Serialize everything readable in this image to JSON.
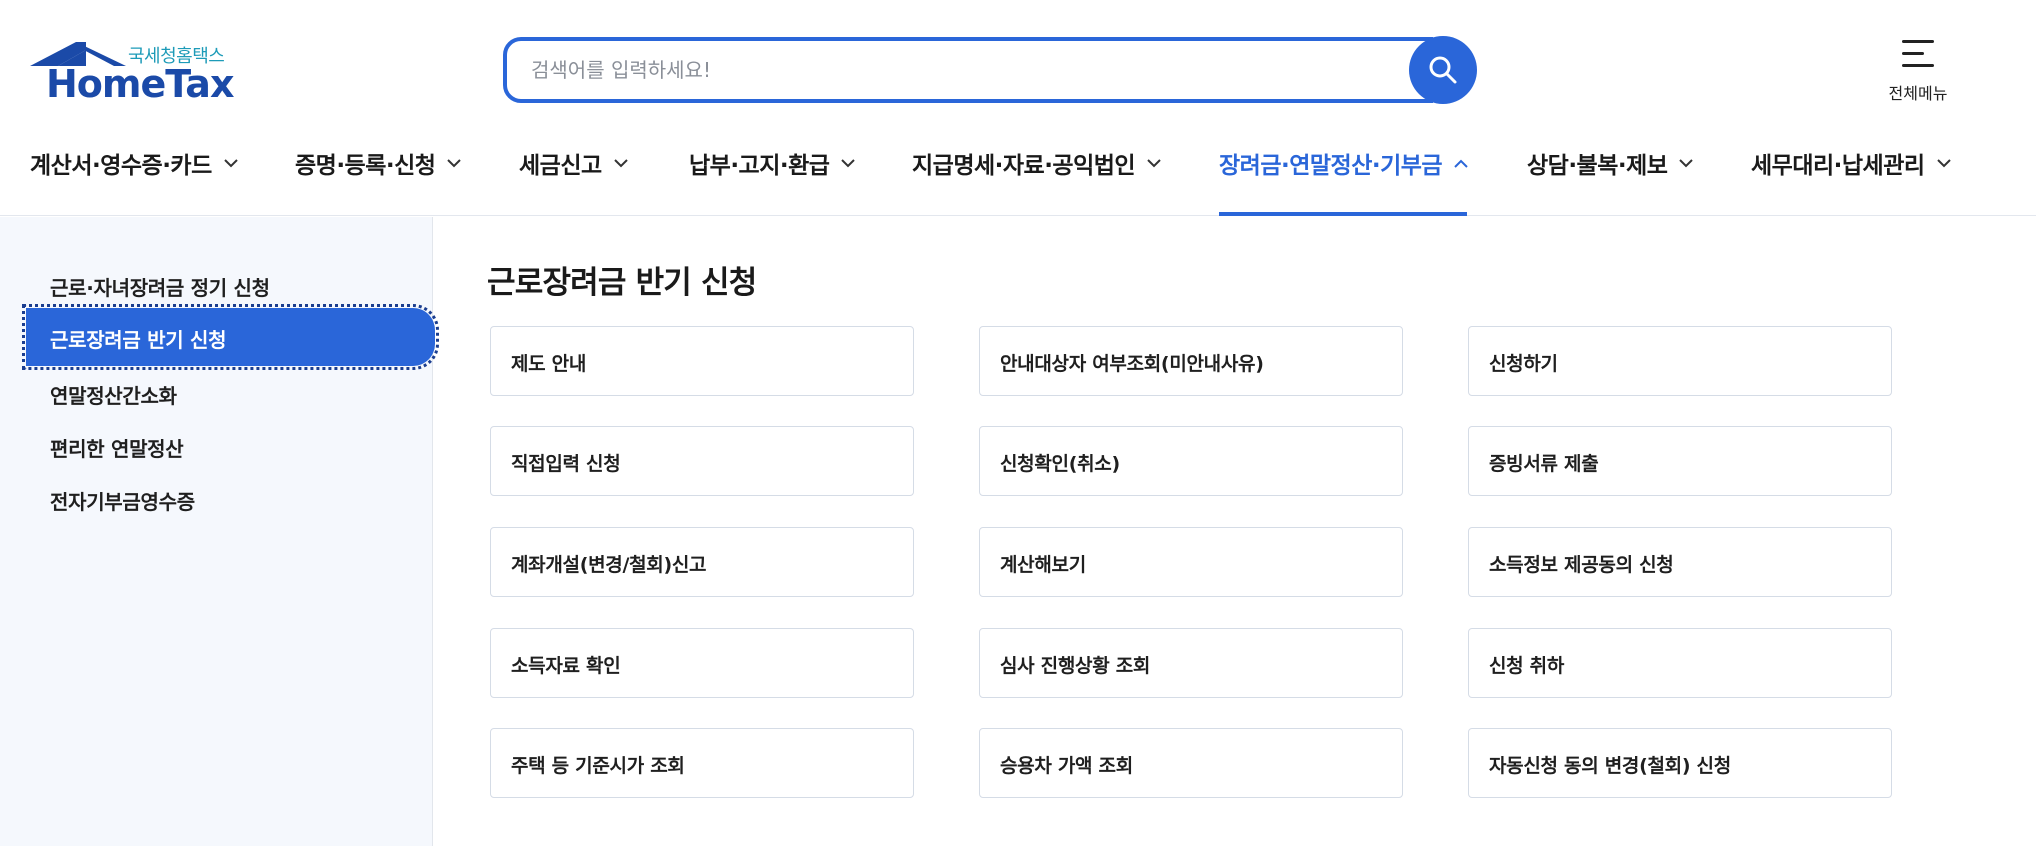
{
  "logo": {
    "korean": "국세청홈택스",
    "english": "HomeTax"
  },
  "search": {
    "placeholder": "검색어를 입력하세요!"
  },
  "all_menu": {
    "label": "전체메뉴"
  },
  "gnb": [
    {
      "label": "계산서·영수증·카드",
      "active": false
    },
    {
      "label": "증명·등록·신청",
      "active": false
    },
    {
      "label": "세금신고",
      "active": false
    },
    {
      "label": "납부·고지·환급",
      "active": false
    },
    {
      "label": "지급명세·자료·공익법인",
      "active": false
    },
    {
      "label": "장려금·연말정산·기부금",
      "active": true
    },
    {
      "label": "상담·불복·제보",
      "active": false
    },
    {
      "label": "세무대리·납세관리",
      "active": false
    }
  ],
  "sidebar": {
    "items": [
      {
        "label": "근로·자녀장려금 정기 신청"
      },
      {
        "label": "근로장려금 반기 신청",
        "selected": true
      },
      {
        "label": "연말정산간소화"
      },
      {
        "label": "편리한 연말정산"
      },
      {
        "label": "전자기부금영수증"
      }
    ]
  },
  "main": {
    "title": "근로장려금 반기 신청",
    "cards": [
      "제도 안내",
      "안내대상자 여부조회(미안내사유)",
      "신청하기",
      "직접입력 신청",
      "신청확인(취소)",
      "증빙서류 제출",
      "계좌개설(변경/철회)신고",
      "계산해보기",
      "소득정보 제공동의 신청",
      "소득자료 확인",
      "심사 진행상황 조회",
      "신청 취하",
      "주택 등 기준시가 조회",
      "승용차 가액 조회",
      "자동신청 동의 변경(철회) 신청"
    ]
  },
  "colors": {
    "accent": "#2a66d9",
    "logo_blue": "#1b4aa8",
    "logo_teal": "#1d9bb8",
    "sidebar_bg": "#f5f8fd"
  }
}
